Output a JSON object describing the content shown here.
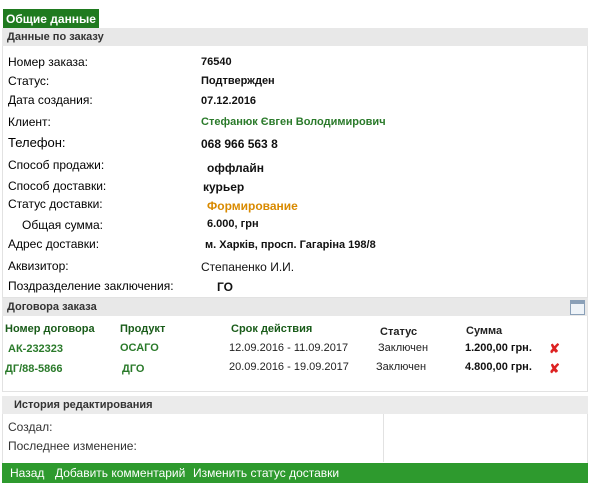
{
  "tab": {
    "label": "Общие данные"
  },
  "order_section": {
    "title": "Данные по заказу",
    "fields": [
      {
        "label": "Номер заказа:",
        "value": "76540"
      },
      {
        "label": "Статус:",
        "value": "Подтвержден"
      },
      {
        "label": "Дата создания:",
        "value": "07.12.2016"
      },
      {
        "label": "Клиент:",
        "value": "Стефанюк Євген Володимирович"
      },
      {
        "label": "Телефон:",
        "value": "068 966 563 8"
      },
      {
        "label": "Способ продажи:",
        "value": "оффлайн"
      },
      {
        "label": "Способ доставки:",
        "value": "курьер"
      },
      {
        "label": "Статус доставки:",
        "value": "Формирование"
      },
      {
        "label": "Общая сумма:",
        "value": "6.000, грн"
      },
      {
        "label": "Адрес доставки:",
        "value": "м. Харків, просп. Гагаріна 198/8"
      },
      {
        "label": "Аквизитор:",
        "value": "Степаненко И.И."
      },
      {
        "label": "Поздразделение заключения:",
        "value": "ГО"
      }
    ]
  },
  "contracts_section": {
    "title": "Договора заказа",
    "columns": [
      "Номер договора",
      "Продукт",
      "Срок действия",
      "Статус",
      "Сумма"
    ],
    "rows": [
      {
        "number": "АК-232323",
        "product": "ОСАГО",
        "period": "12.09.2016 - 11.09.2017",
        "status": "Заключен",
        "amount": "1.200,00 грн."
      },
      {
        "number": "ДГ/88-5866",
        "product": "ДГО",
        "period": "20.09.2016 - 19.09.2017",
        "status": "Заключен",
        "amount": "4.800,00 грн."
      }
    ]
  },
  "history_section": {
    "title": "История редактирования",
    "created_label": "Создал:",
    "last_change_label": "Последнее изменение:"
  },
  "footer": {
    "back": "Назад",
    "add_comment": "Добавить комментарий",
    "change_status": "Изменить статус  доставки"
  },
  "colors": {
    "accent_green": "#2e9a2e",
    "tab_green": "#1f7a1f",
    "link_green": "#2a7a2a",
    "warning_orange": "#d98a00"
  },
  "icons": {
    "delete": "delete-icon",
    "calendar": "calendar-icon"
  }
}
